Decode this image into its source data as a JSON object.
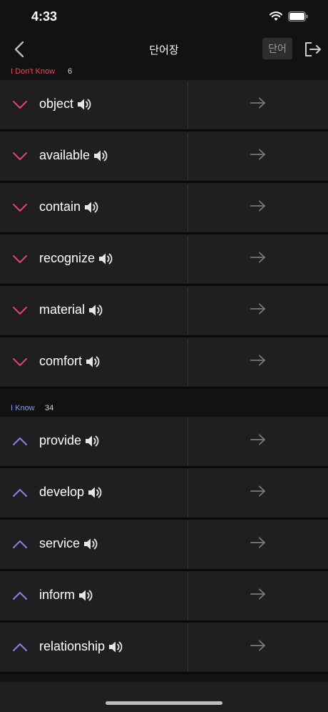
{
  "status_bar": {
    "time": "4:33"
  },
  "nav": {
    "title": "단어장",
    "word_button": "단어"
  },
  "colors": {
    "dont_know": "#e0485f",
    "know": "#7f86e3",
    "label_dont_know": "#e0485f",
    "label_know": "#8f96f0"
  },
  "sections": {
    "dont_know": {
      "label": "I Don't Know",
      "count": "6",
      "words": [
        "object",
        "available",
        "contain",
        "recognize",
        "material",
        "comfort"
      ]
    },
    "know": {
      "label": "I Know",
      "count": "34",
      "words": [
        "provide",
        "develop",
        "service",
        "inform",
        "relationship"
      ]
    }
  },
  "icons": {
    "back": "chevron-left-icon",
    "logout": "logout-icon",
    "speaker": "speaker-icon",
    "arrow": "arrow-right-icon",
    "dont_know_chevron": "chevron-down-icon",
    "know_chevron": "chevron-up-icon"
  }
}
